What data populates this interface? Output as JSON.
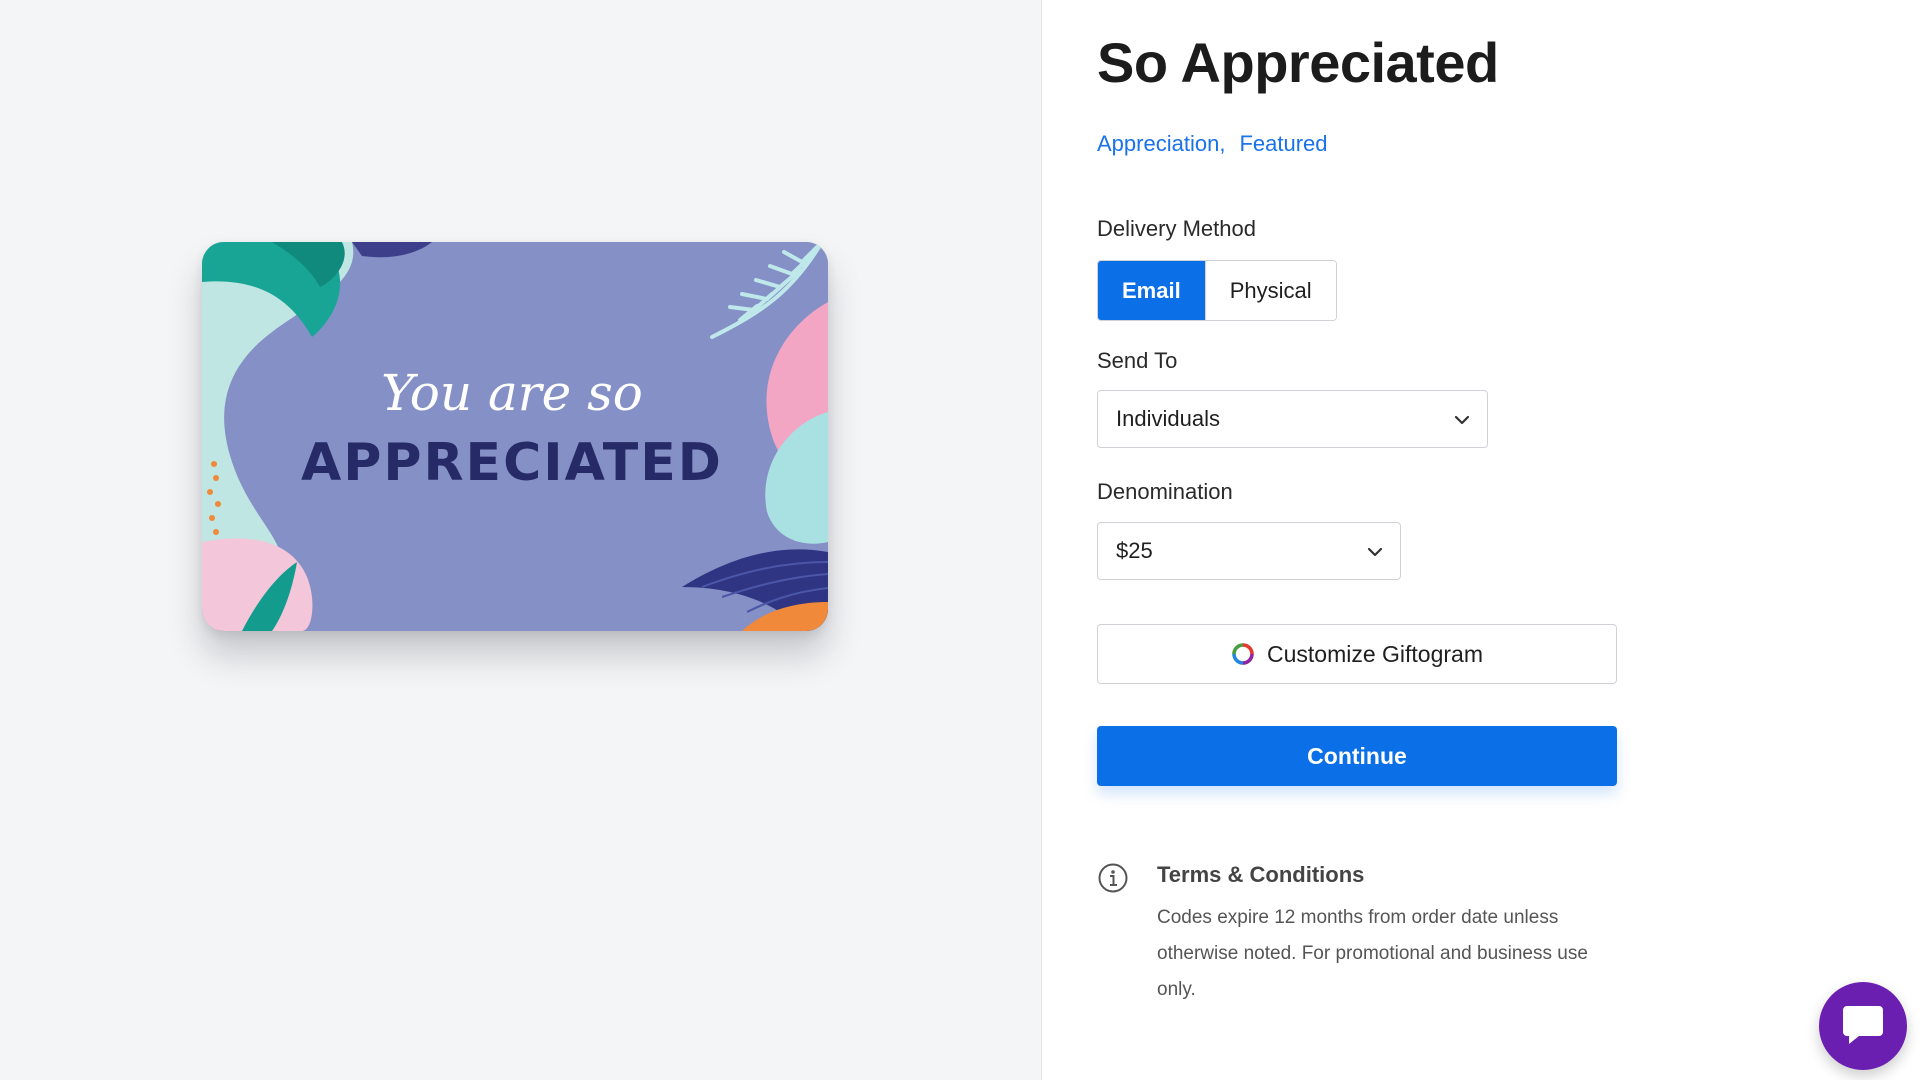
{
  "product": {
    "title": "So Appreciated",
    "categories": [
      "Appreciation",
      "Featured"
    ],
    "category_separator": ","
  },
  "card_art": {
    "line1": "You are so",
    "line2": "APPRECIATED"
  },
  "delivery": {
    "label": "Delivery Method",
    "options": [
      "Email",
      "Physical"
    ],
    "selected": "Email"
  },
  "send_to": {
    "label": "Send To",
    "value": "Individuals"
  },
  "denomination": {
    "label": "Denomination",
    "value": "$25"
  },
  "customize": {
    "label": "Customize Giftogram"
  },
  "continue": {
    "label": "Continue"
  },
  "terms": {
    "title": "Terms & Conditions",
    "body": "Codes expire 12 months from order date unless otherwise noted. For promotional and business use only."
  },
  "colors": {
    "primary": "#0b6fe8",
    "link": "#1a73e8",
    "card_bg": "#8590c6",
    "chat": "#6b1fb1"
  },
  "icons": {
    "chevron": "chevron-down-icon",
    "info": "info-icon",
    "customize": "color-ring-icon",
    "chat": "chat-bubble-icon"
  }
}
